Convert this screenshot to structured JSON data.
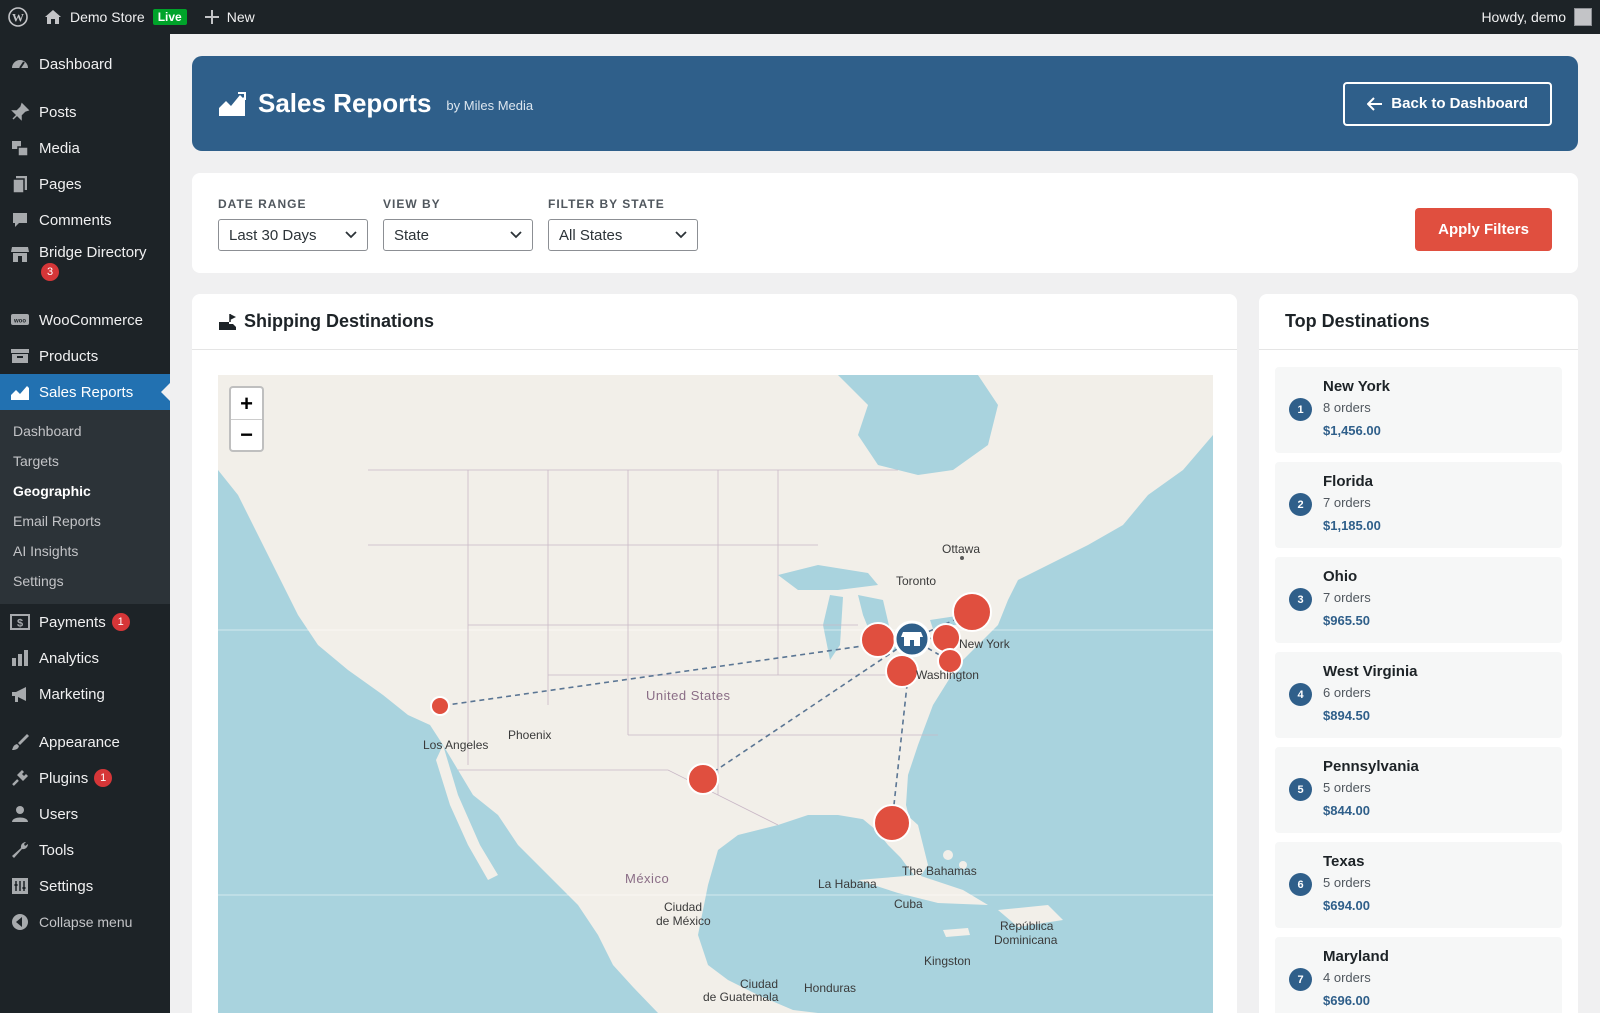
{
  "adminbar": {
    "site_name": "Demo Store",
    "live_badge": "Live",
    "new_label": "New",
    "howdy": "Howdy, demo"
  },
  "sidebar": {
    "items": [
      {
        "label": "Dashboard",
        "icon": "dashboard-icon"
      },
      {
        "label": "Posts",
        "icon": "pin-icon"
      },
      {
        "label": "Media",
        "icon": "media-icon"
      },
      {
        "label": "Pages",
        "icon": "pages-icon"
      },
      {
        "label": "Comments",
        "icon": "comments-icon"
      },
      {
        "label": "Bridge Directory",
        "icon": "store-icon",
        "badge": "3"
      },
      {
        "label": "WooCommerce",
        "icon": "woo-icon"
      },
      {
        "label": "Products",
        "icon": "archive-icon"
      },
      {
        "label": "Sales Reports",
        "icon": "chart-icon"
      },
      {
        "label": "Payments",
        "icon": "dollar-icon",
        "badge": "1"
      },
      {
        "label": "Analytics",
        "icon": "bar-chart-icon"
      },
      {
        "label": "Marketing",
        "icon": "megaphone-icon"
      },
      {
        "label": "Appearance",
        "icon": "brush-icon"
      },
      {
        "label": "Plugins",
        "icon": "plug-icon",
        "badge": "1"
      },
      {
        "label": "Users",
        "icon": "user-icon"
      },
      {
        "label": "Tools",
        "icon": "wrench-icon"
      },
      {
        "label": "Settings",
        "icon": "settings-icon"
      },
      {
        "label": "Collapse menu",
        "icon": "collapse-icon"
      }
    ],
    "submenu": [
      "Dashboard",
      "Targets",
      "Geographic",
      "Email Reports",
      "AI Insights",
      "Settings"
    ],
    "current_submenu": "Geographic"
  },
  "header": {
    "title": "Sales Reports",
    "byline": "by Miles Media",
    "back_label": "Back to Dashboard"
  },
  "filters": {
    "date_range_label": "Date Range",
    "date_range_value": "Last 30 Days",
    "view_by_label": "View By",
    "view_by_value": "State",
    "filter_state_label": "Filter by State",
    "filter_state_value": "All States",
    "apply_label": "Apply Filters"
  },
  "map": {
    "title": "Shipping Destinations",
    "zoom_in": "+",
    "zoom_out": "−",
    "labels": {
      "ottawa": "Ottawa",
      "toronto": "Toronto",
      "new_york": "New York",
      "washington": "Washington",
      "united_states": "United States",
      "phoenix": "Phoenix",
      "los_angeles": "Los Angeles",
      "the_bahamas": "The Bahamas",
      "la_habana": "La Habana",
      "cuba": "Cuba",
      "mexico": "México",
      "ciudad_de_mexico_1": "Ciudad",
      "ciudad_de_mexico_2": "de México",
      "republica_1": "República",
      "republica_2": "Dominicana",
      "kingston": "Kingston",
      "guatemala_1": "Ciudad",
      "guatemala_2": "de Guatemala",
      "honduras": "Honduras"
    },
    "colors": {
      "marker": "#e04f3f",
      "store": "#2f5f8a",
      "water": "#a9d3de",
      "land": "#f2efe9"
    }
  },
  "top_destinations": {
    "title": "Top Destinations",
    "items": [
      {
        "rank": "1",
        "name": "New York",
        "orders": "8 orders",
        "revenue": "$1,456.00"
      },
      {
        "rank": "2",
        "name": "Florida",
        "orders": "7 orders",
        "revenue": "$1,185.00"
      },
      {
        "rank": "3",
        "name": "Ohio",
        "orders": "7 orders",
        "revenue": "$965.50"
      },
      {
        "rank": "4",
        "name": "West Virginia",
        "orders": "6 orders",
        "revenue": "$894.50"
      },
      {
        "rank": "5",
        "name": "Pennsylvania",
        "orders": "5 orders",
        "revenue": "$844.00"
      },
      {
        "rank": "6",
        "name": "Texas",
        "orders": "5 orders",
        "revenue": "$694.00"
      },
      {
        "rank": "7",
        "name": "Maryland",
        "orders": "4 orders",
        "revenue": "$696.00"
      }
    ]
  }
}
